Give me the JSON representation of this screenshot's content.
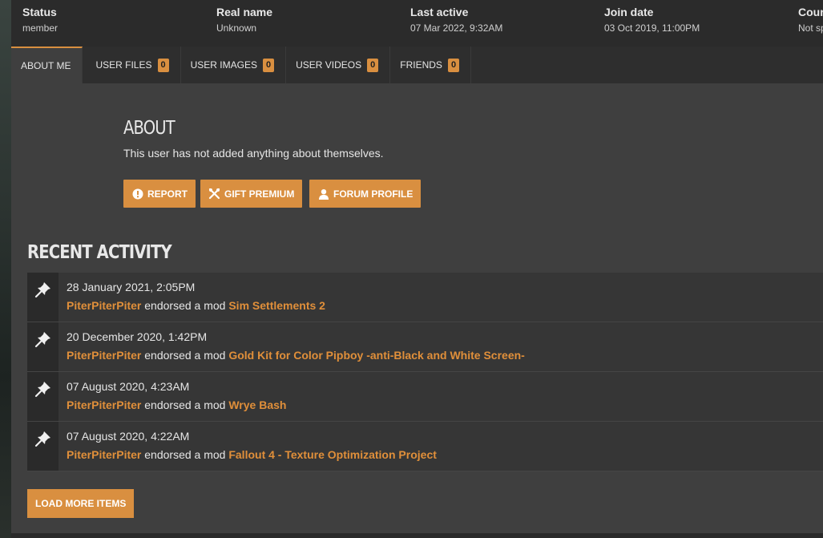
{
  "stats": [
    {
      "label": "Status",
      "value": "member"
    },
    {
      "label": "Real name",
      "value": "Unknown"
    },
    {
      "label": "Last active",
      "value": "07 Mar 2022,  9:32AM"
    },
    {
      "label": "Join date",
      "value": "03 Oct 2019,  11:00PM"
    },
    {
      "label": "Cour",
      "value": "Not sp"
    }
  ],
  "tabs": [
    {
      "label": "ABOUT ME"
    },
    {
      "label": "USER FILES",
      "count": "0"
    },
    {
      "label": "USER IMAGES",
      "count": "0"
    },
    {
      "label": "USER VIDEOS",
      "count": "0"
    },
    {
      "label": "FRIENDS",
      "count": "0"
    }
  ],
  "about": {
    "title": "ABOUT",
    "text": "This user has not added anything about themselves.",
    "buttons": {
      "report": "REPORT",
      "gift": "GIFT PREMIUM",
      "forum": "FORUM PROFILE"
    }
  },
  "recent": {
    "title": "RECENT ACTIVITY",
    "items": [
      {
        "time": "28 January 2021, 2:05PM",
        "user": "PiterPiterPiter",
        "action": " endorsed a mod ",
        "mod": "Sim Settlements 2"
      },
      {
        "time": "20 December 2020, 1:42PM",
        "user": "PiterPiterPiter",
        "action": " endorsed a mod ",
        "mod": "Gold Kit for Color Pipboy -anti-Black and White Screen-"
      },
      {
        "time": "07 August 2020, 4:23AM",
        "user": "PiterPiterPiter",
        "action": " endorsed a mod ",
        "mod": "Wrye Bash"
      },
      {
        "time": "07 August 2020, 4:22AM",
        "user": "PiterPiterPiter",
        "action": " endorsed a mod ",
        "mod": "Fallout 4 - Texture Optimization Project"
      }
    ],
    "load_more": "LOAD MORE ITEMS"
  },
  "colors": {
    "accent": "#d98f40",
    "link": "#e08f3a",
    "panel": "#3f3f3f",
    "bar": "#2b2b2b"
  },
  "icons": {
    "activity": "pin-icon",
    "report": "alert-icon",
    "gift": "gift-icon",
    "forum": "user-icon"
  }
}
